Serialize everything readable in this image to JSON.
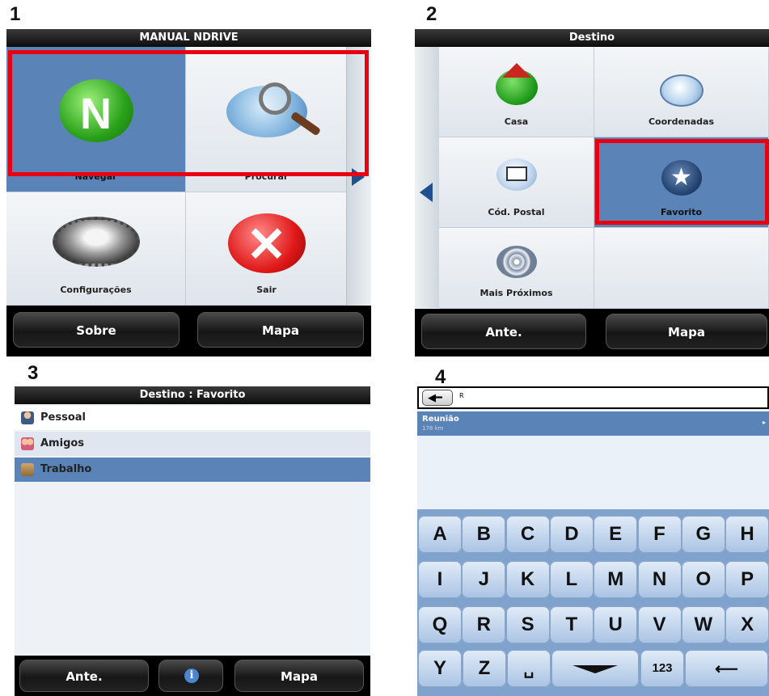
{
  "step_numbers": [
    "1",
    "2",
    "3",
    "4"
  ],
  "screen1": {
    "title": "MANUAL NDRIVE",
    "tiles": [
      "Navegar",
      "Procurar",
      "Configurações",
      "Sair"
    ],
    "bottom_buttons": [
      "Sobre",
      "Mapa"
    ]
  },
  "screen2": {
    "title": "Destino",
    "tiles": [
      "Casa",
      "Coordenadas",
      "Cód. Postal",
      "Favorito",
      "Mais Próximos"
    ],
    "bottom_buttons": [
      "Ante.",
      "Mapa"
    ]
  },
  "screen3": {
    "title": "Destino : Favorito",
    "items": [
      "Pessoal",
      "Amigos",
      "Trabalho"
    ],
    "bottom_buttons": [
      "Ante.",
      "Mapa"
    ]
  },
  "screen4": {
    "input_value": "R",
    "result_name": "Reunião",
    "result_distance": "178 km",
    "keys_row1": [
      "A",
      "B",
      "C",
      "D",
      "E",
      "F",
      "G",
      "H"
    ],
    "keys_row2": [
      "I",
      "J",
      "K",
      "L",
      "M",
      "N",
      "O",
      "P"
    ],
    "keys_row3": [
      "Q",
      "R",
      "S",
      "T",
      "U",
      "V",
      "W",
      "X"
    ],
    "keys_row4": [
      "Y",
      "Z"
    ],
    "numbers_key": "123"
  },
  "colors": {
    "highlight": "#e60012",
    "selected": "#5a84b8",
    "bar": "#000000"
  }
}
